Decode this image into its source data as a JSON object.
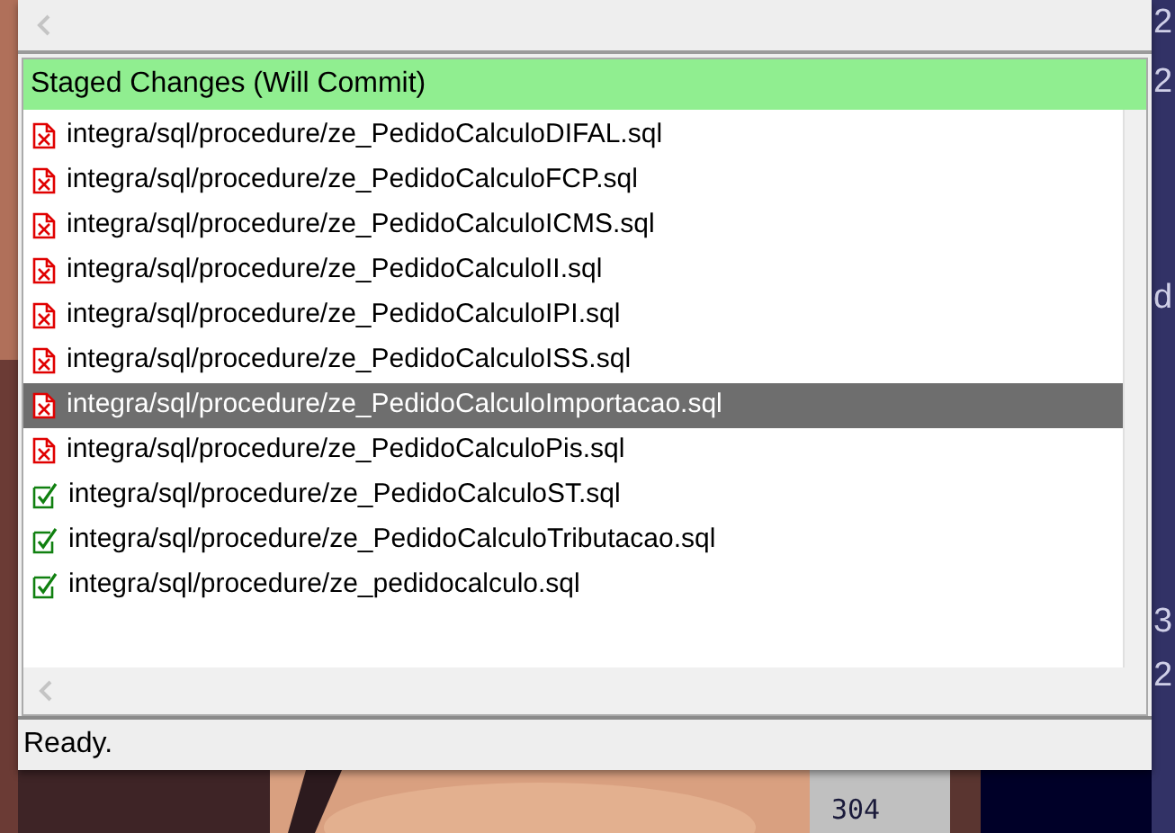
{
  "staged_panel": {
    "title": "Staged Changes (Will Commit)",
    "files": [
      {
        "path": "integra/sql/procedure/ze_PedidoCalculoDIFAL.sql",
        "kind": "deleted",
        "selected": false
      },
      {
        "path": "integra/sql/procedure/ze_PedidoCalculoFCP.sql",
        "kind": "deleted",
        "selected": false
      },
      {
        "path": "integra/sql/procedure/ze_PedidoCalculoICMS.sql",
        "kind": "deleted",
        "selected": false
      },
      {
        "path": "integra/sql/procedure/ze_PedidoCalculoII.sql",
        "kind": "deleted",
        "selected": false
      },
      {
        "path": "integra/sql/procedure/ze_PedidoCalculoIPI.sql",
        "kind": "deleted",
        "selected": false
      },
      {
        "path": "integra/sql/procedure/ze_PedidoCalculoISS.sql",
        "kind": "deleted",
        "selected": false
      },
      {
        "path": "integra/sql/procedure/ze_PedidoCalculoImportacao.sql",
        "kind": "deleted",
        "selected": true
      },
      {
        "path": "integra/sql/procedure/ze_PedidoCalculoPis.sql",
        "kind": "deleted",
        "selected": false
      },
      {
        "path": "integra/sql/procedure/ze_PedidoCalculoST.sql",
        "kind": "added",
        "selected": false
      },
      {
        "path": "integra/sql/procedure/ze_PedidoCalculoTributacao.sql",
        "kind": "added",
        "selected": false
      },
      {
        "path": "integra/sql/procedure/ze_pedidocalculo.sql",
        "kind": "added",
        "selected": false
      }
    ]
  },
  "status_bar": {
    "text": "Ready."
  },
  "background_editor": {
    "fragments": [
      "2",
      "2",
      "d",
      "3",
      "2"
    ]
  },
  "background_gutter": {
    "line_number": "304"
  }
}
